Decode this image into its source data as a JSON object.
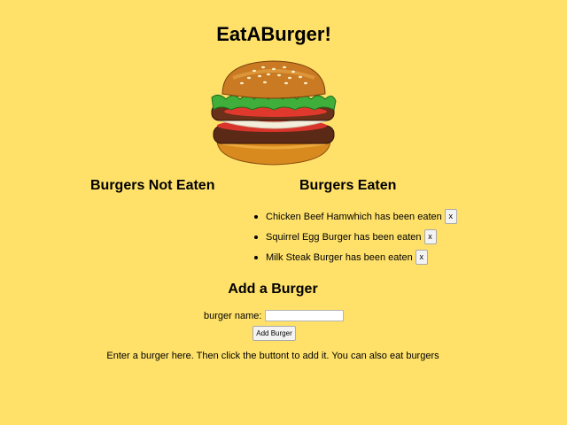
{
  "header": {
    "title": "EatABurger!",
    "logo_icon": "burger-icon"
  },
  "columns": {
    "not_eaten_heading": "Burgers Not Eaten",
    "eaten_heading": "Burgers Eaten",
    "not_eaten_items": [],
    "eaten_items": [
      {
        "label": "Chicken Beef Hamwhich has been eaten",
        "delete_label": "x"
      },
      {
        "label": "Squirrel Egg Burger has been eaten",
        "delete_label": "x"
      },
      {
        "label": "Milk Steak Burger has been eaten",
        "delete_label": "x"
      }
    ]
  },
  "add_form": {
    "heading": "Add a Burger",
    "name_label": "burger name:",
    "name_value": "",
    "submit_label": "Add Burger",
    "help_text": "Enter a burger here. Then click the buttont to add it. You can also eat burgers"
  },
  "colors": {
    "background": "#FFE16A"
  }
}
